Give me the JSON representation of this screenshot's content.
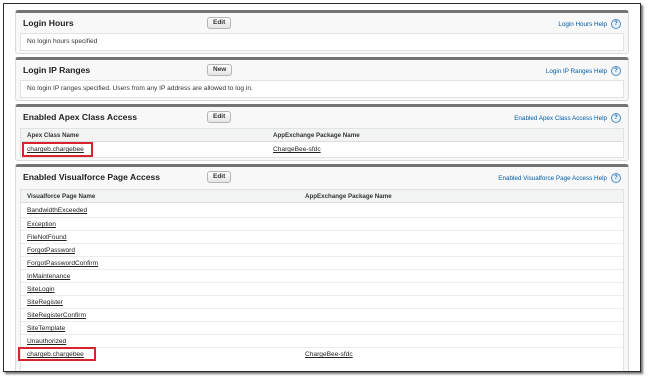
{
  "login_hours": {
    "title": "Login Hours",
    "edit_label": "Edit",
    "help_label": "Login Hours Help",
    "message": "No login hours specified"
  },
  "login_ip": {
    "title": "Login IP Ranges",
    "new_label": "New",
    "help_label": "Login IP Ranges Help",
    "message": "No login IP ranges specified. Users from any IP address are allowed to log in."
  },
  "apex": {
    "title": "Enabled Apex Class Access",
    "edit_label": "Edit",
    "help_label": "Enabled Apex Class Access Help",
    "columns": [
      "Apex Class Name",
      "AppExchange Package Name"
    ],
    "rows": [
      {
        "name": "chargeb.chargebee",
        "package": "ChargeBee-sfdc"
      }
    ]
  },
  "vf": {
    "title": "Enabled Visualforce Page Access",
    "edit_label": "Edit",
    "help_label": "Enabled Visualforce Page Access Help",
    "columns": [
      "Visualforce Page Name",
      "AppExchange Package Name"
    ],
    "rows": [
      {
        "name": "BandwidthExceeded",
        "package": ""
      },
      {
        "name": "Exception",
        "package": ""
      },
      {
        "name": "FileNotFound",
        "package": ""
      },
      {
        "name": "ForgotPassword",
        "package": ""
      },
      {
        "name": "ForgotPasswordConfirm",
        "package": ""
      },
      {
        "name": "InMaintenance",
        "package": ""
      },
      {
        "name": "SiteLogin",
        "package": ""
      },
      {
        "name": "SiteRegister",
        "package": ""
      },
      {
        "name": "SiteRegisterConfirm",
        "package": ""
      },
      {
        "name": "SiteTemplate",
        "package": ""
      },
      {
        "name": "Unauthorized",
        "package": ""
      },
      {
        "name": "chargeb.chargebee",
        "package": "ChargeBee-sfdc"
      }
    ]
  },
  "help_icon_glyph": "?",
  "colors": {
    "header_bar": "#747474",
    "link_blue": "#015ba7",
    "highlight_red": "#d9232e"
  }
}
